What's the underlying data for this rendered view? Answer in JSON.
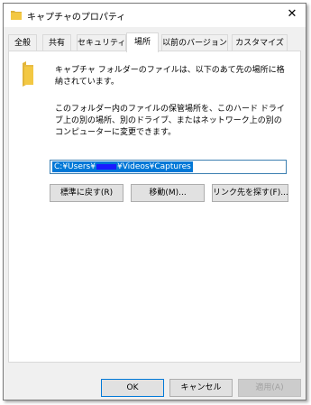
{
  "window": {
    "title": "キャプチャのプロパティ",
    "close_glyph": "✕"
  },
  "tabs": [
    {
      "label": "全般",
      "active": false
    },
    {
      "label": "共有",
      "active": false
    },
    {
      "label": "セキュリティ",
      "active": false
    },
    {
      "label": "場所",
      "active": true
    },
    {
      "label": "以前のバージョン",
      "active": false
    },
    {
      "label": "カスタマイズ",
      "active": false
    }
  ],
  "location": {
    "description1": "キャプチャ フォルダーのファイルは、以下のあて先の場所に格納されています。",
    "description2": "このフォルダー内のファイルの保管場所を、このハード ドライブ上の別の場所、別のドライブ、またはネットワーク上の別のコンピューターに変更できます。",
    "path_before": "C:¥Users¥",
    "path_after": "¥Videos¥Captures",
    "restore_default": "標準に戻す(R)",
    "move": "移動(M)...",
    "find_target": "リンク先を探す(F)..."
  },
  "footer": {
    "ok": "OK",
    "cancel": "キャンセル",
    "apply": "適用(A)"
  },
  "colors": {
    "selection": "#0078d7",
    "folder": "#f3c843",
    "redaction": "#1a1aff"
  }
}
